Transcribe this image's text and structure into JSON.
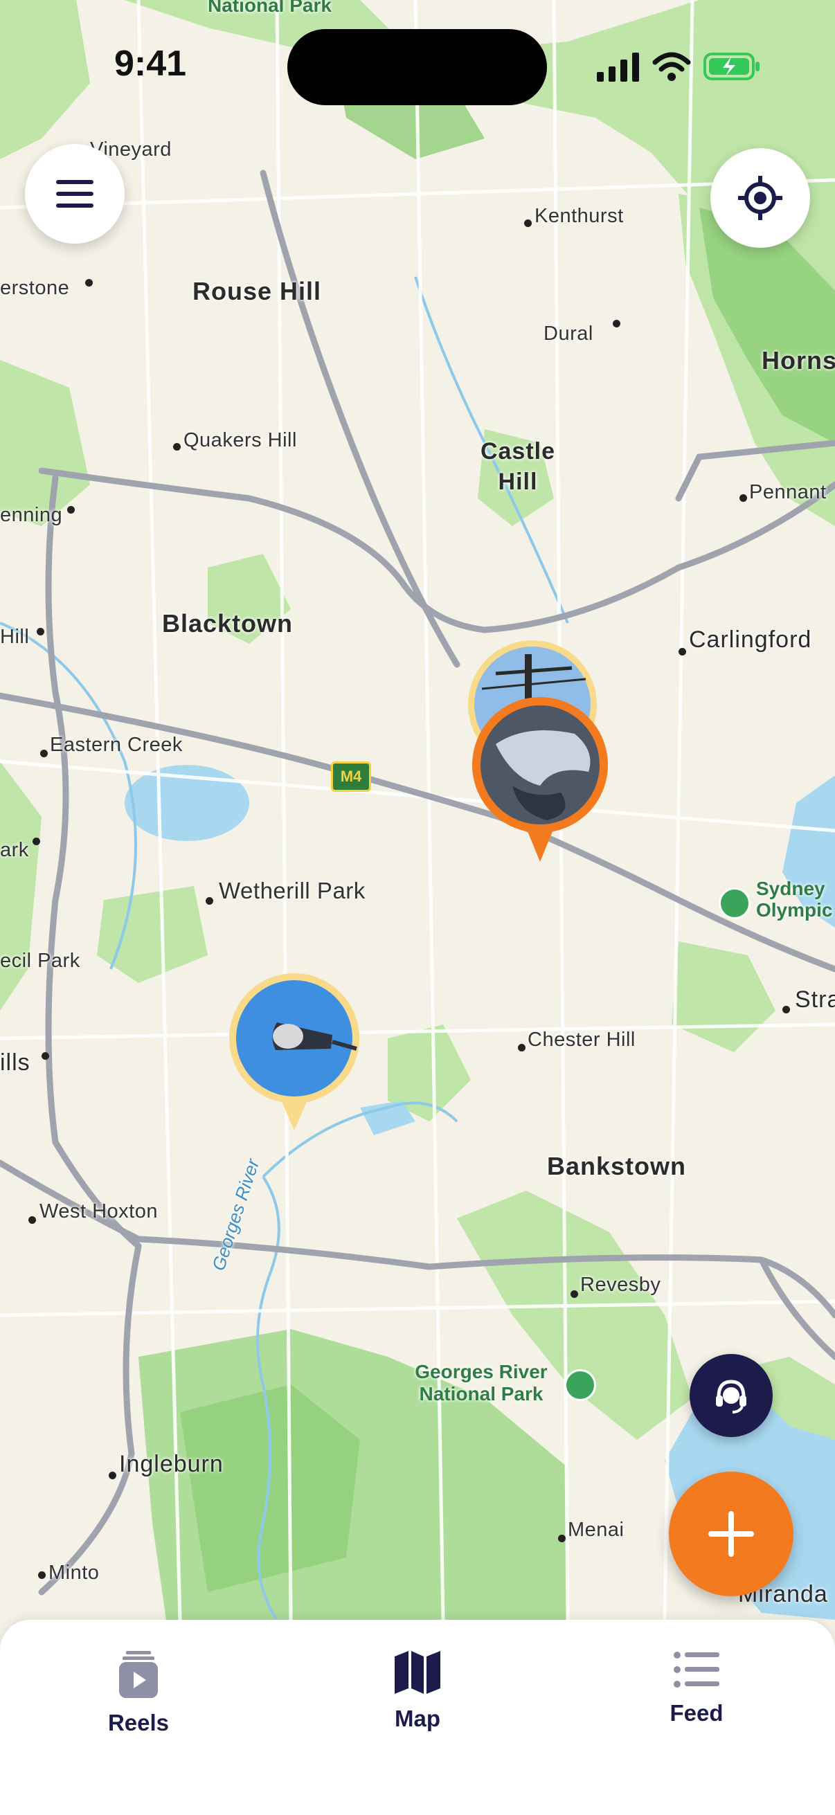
{
  "status_bar": {
    "time": "9:41"
  },
  "map": {
    "labels": {
      "national_park_top": "National Park",
      "vineyard": "Vineyard",
      "kenthurst": "Kenthurst",
      "rouse_hill": "Rouse Hill",
      "riverstone": "erstone",
      "dural": "Dural",
      "hornsby": "Horns",
      "quakers_hill": "Quakers Hill",
      "castle_hill": "Castle Hill",
      "pennant": "Pennant",
      "glenning": "enning",
      "blacktown": "Blacktown",
      "hill_left": "Hill",
      "carlingford": "Carlingford",
      "eastern_creek": "Eastern Creek",
      "m4": "M4",
      "park_left": "ark",
      "wetherill_park": "Wetherill Park",
      "sydney_olympic": "Sydney Olympic",
      "cecil_park": "ecil Park",
      "strathfield": "Stra",
      "hills_left": "ills",
      "chester_hill": "Chester Hill",
      "bankstown": "Bankstown",
      "west_hoxton": "West Hoxton",
      "georges_river": "Georges River",
      "revesby": "Revesby",
      "georges_river_np": "Georges River National Park",
      "ingleburn": "Ingleburn",
      "menai": "Menai",
      "minto": "Minto",
      "miranda": "Miranda"
    }
  },
  "controls": {
    "menu_icon": "hamburger-menu-icon",
    "locate_icon": "crosshair-location-icon",
    "support_icon": "headset-support-icon",
    "add_icon": "plus-icon"
  },
  "tabs": [
    {
      "label": "Reels",
      "icon": "reels-icon"
    },
    {
      "label": "Map",
      "icon": "map-icon"
    },
    {
      "label": "Feed",
      "icon": "list-icon"
    }
  ],
  "colors": {
    "accent": "#f47a1f",
    "navy": "#1c1b4b",
    "pin_yellow": "#f9d98a",
    "land": "#f4f1e6",
    "green": "#a9dc8f",
    "water": "#a8d8f0"
  }
}
